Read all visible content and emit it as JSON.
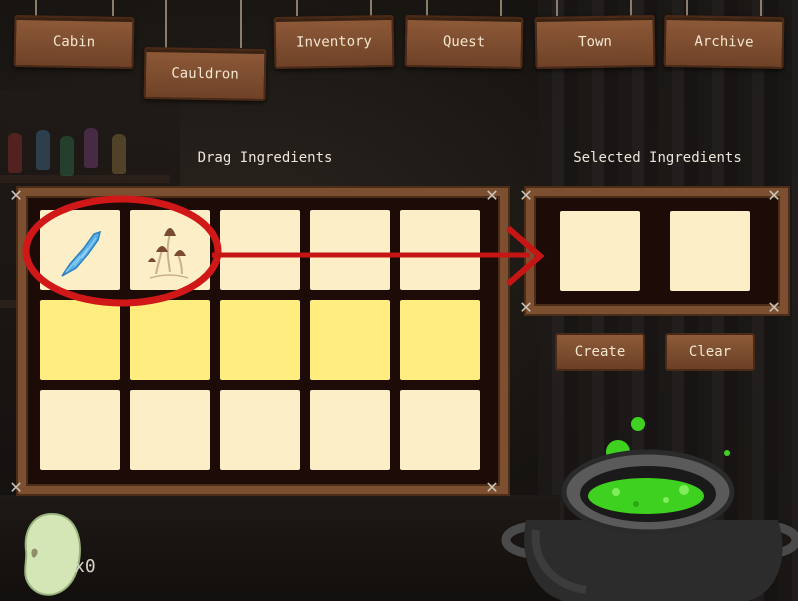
{
  "nav": {
    "cabin": "Cabin",
    "cauldron": "Cauldron",
    "inventory": "Inventory",
    "quest": "Quest",
    "town": "Town",
    "archive": "Archive"
  },
  "drag_panel": {
    "title": "Drag Ingredients"
  },
  "selected_panel": {
    "title": "Selected Ingredients"
  },
  "ingredients": [
    {
      "name": "blue-feather-icon",
      "slot": 1
    },
    {
      "name": "mushrooms-icon",
      "slot": 2
    }
  ],
  "actions": {
    "create": "Create",
    "clear": "Clear"
  },
  "bean": {
    "count": "x0"
  },
  "colors": {
    "highlight_ring": "#d01818",
    "arrow": "#c61515",
    "potion": "#3fd11f",
    "cell_cream": "#fcefc7",
    "cell_yellow": "#ffed7f"
  }
}
